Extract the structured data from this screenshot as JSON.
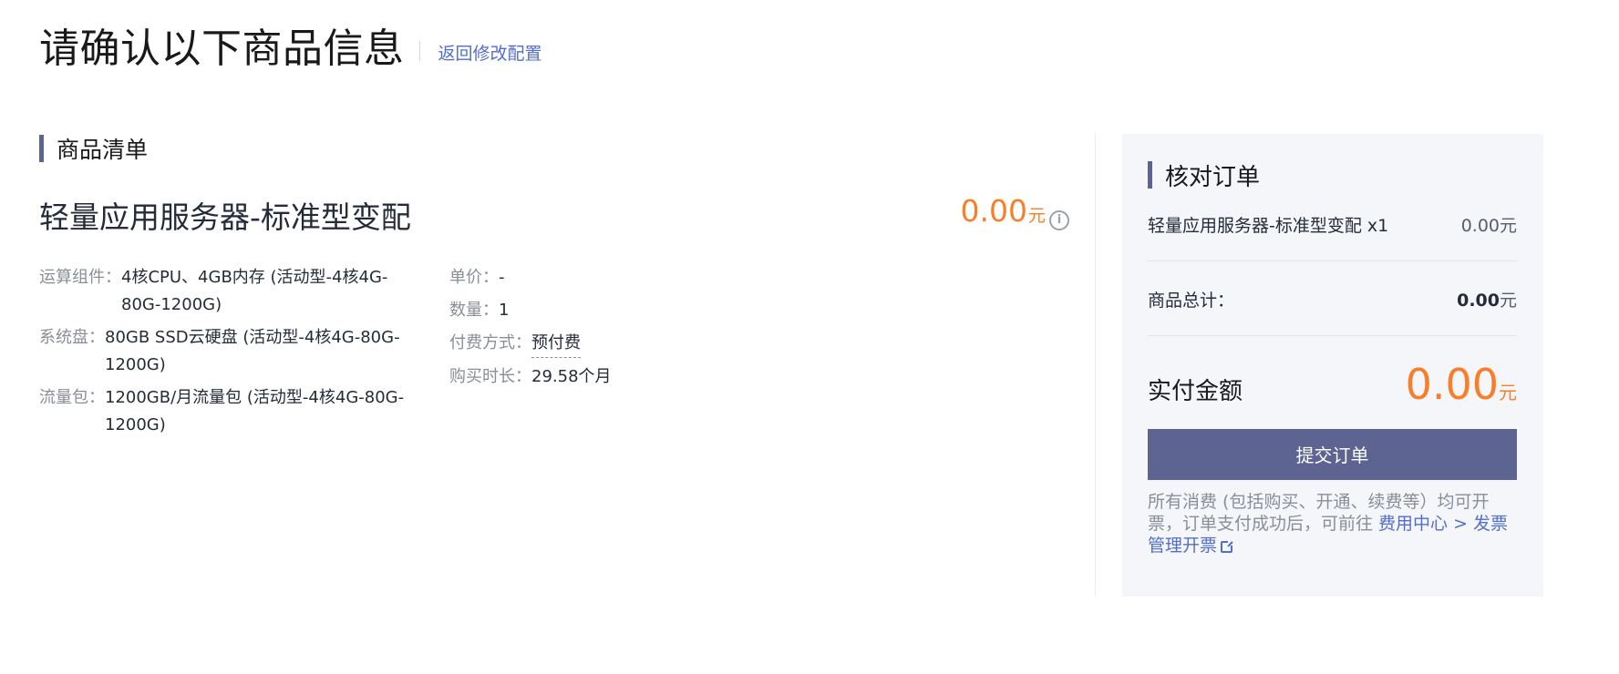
{
  "header": {
    "title": "请确认以下商品信息",
    "back_link": "返回修改配置"
  },
  "product_list": {
    "heading": "商品清单",
    "product_name": "轻量应用服务器-标准型变配",
    "price": "0.00",
    "price_unit": "元",
    "info_icon": "info-circle-icon",
    "specs": [
      {
        "label": "运算组件：",
        "value": "4核CPU、4GB内存 (活动型-4核4G-80G-1200G)"
      },
      {
        "label": "系统盘：",
        "value": "80GB SSD云硬盘 (活动型-4核4G-80G-1200G)"
      },
      {
        "label": "流量包：",
        "value": "1200GB/月流量包 (活动型-4核4G-80G-1200G)"
      }
    ],
    "meta": [
      {
        "label": "单价：",
        "value": "-"
      },
      {
        "label": "数量：",
        "value": "1"
      },
      {
        "label": "付费方式：",
        "value": "预付费"
      },
      {
        "label": "购买时长：",
        "value": "29.58个月"
      }
    ]
  },
  "order_panel": {
    "heading": "核对订单",
    "item_name": "轻量应用服务器-标准型变配 x1",
    "item_price": "0.00元",
    "subtotal_label": "商品总计：",
    "subtotal_value": "0.00",
    "subtotal_unit": "元",
    "pay_label": "实付金额",
    "pay_amount": "0.00",
    "pay_unit": "元",
    "submit_label": "提交订单",
    "note_text": "所有消费 (包括购买、开通、续费等）均可开票，订单支付成功后，可前往 ",
    "note_link": "费用中心 > 发票管理开票",
    "external_icon": "external-link-icon"
  },
  "colors": {
    "accent": "#5e6491",
    "price": "#fa7e29",
    "link": "#526ecc"
  }
}
